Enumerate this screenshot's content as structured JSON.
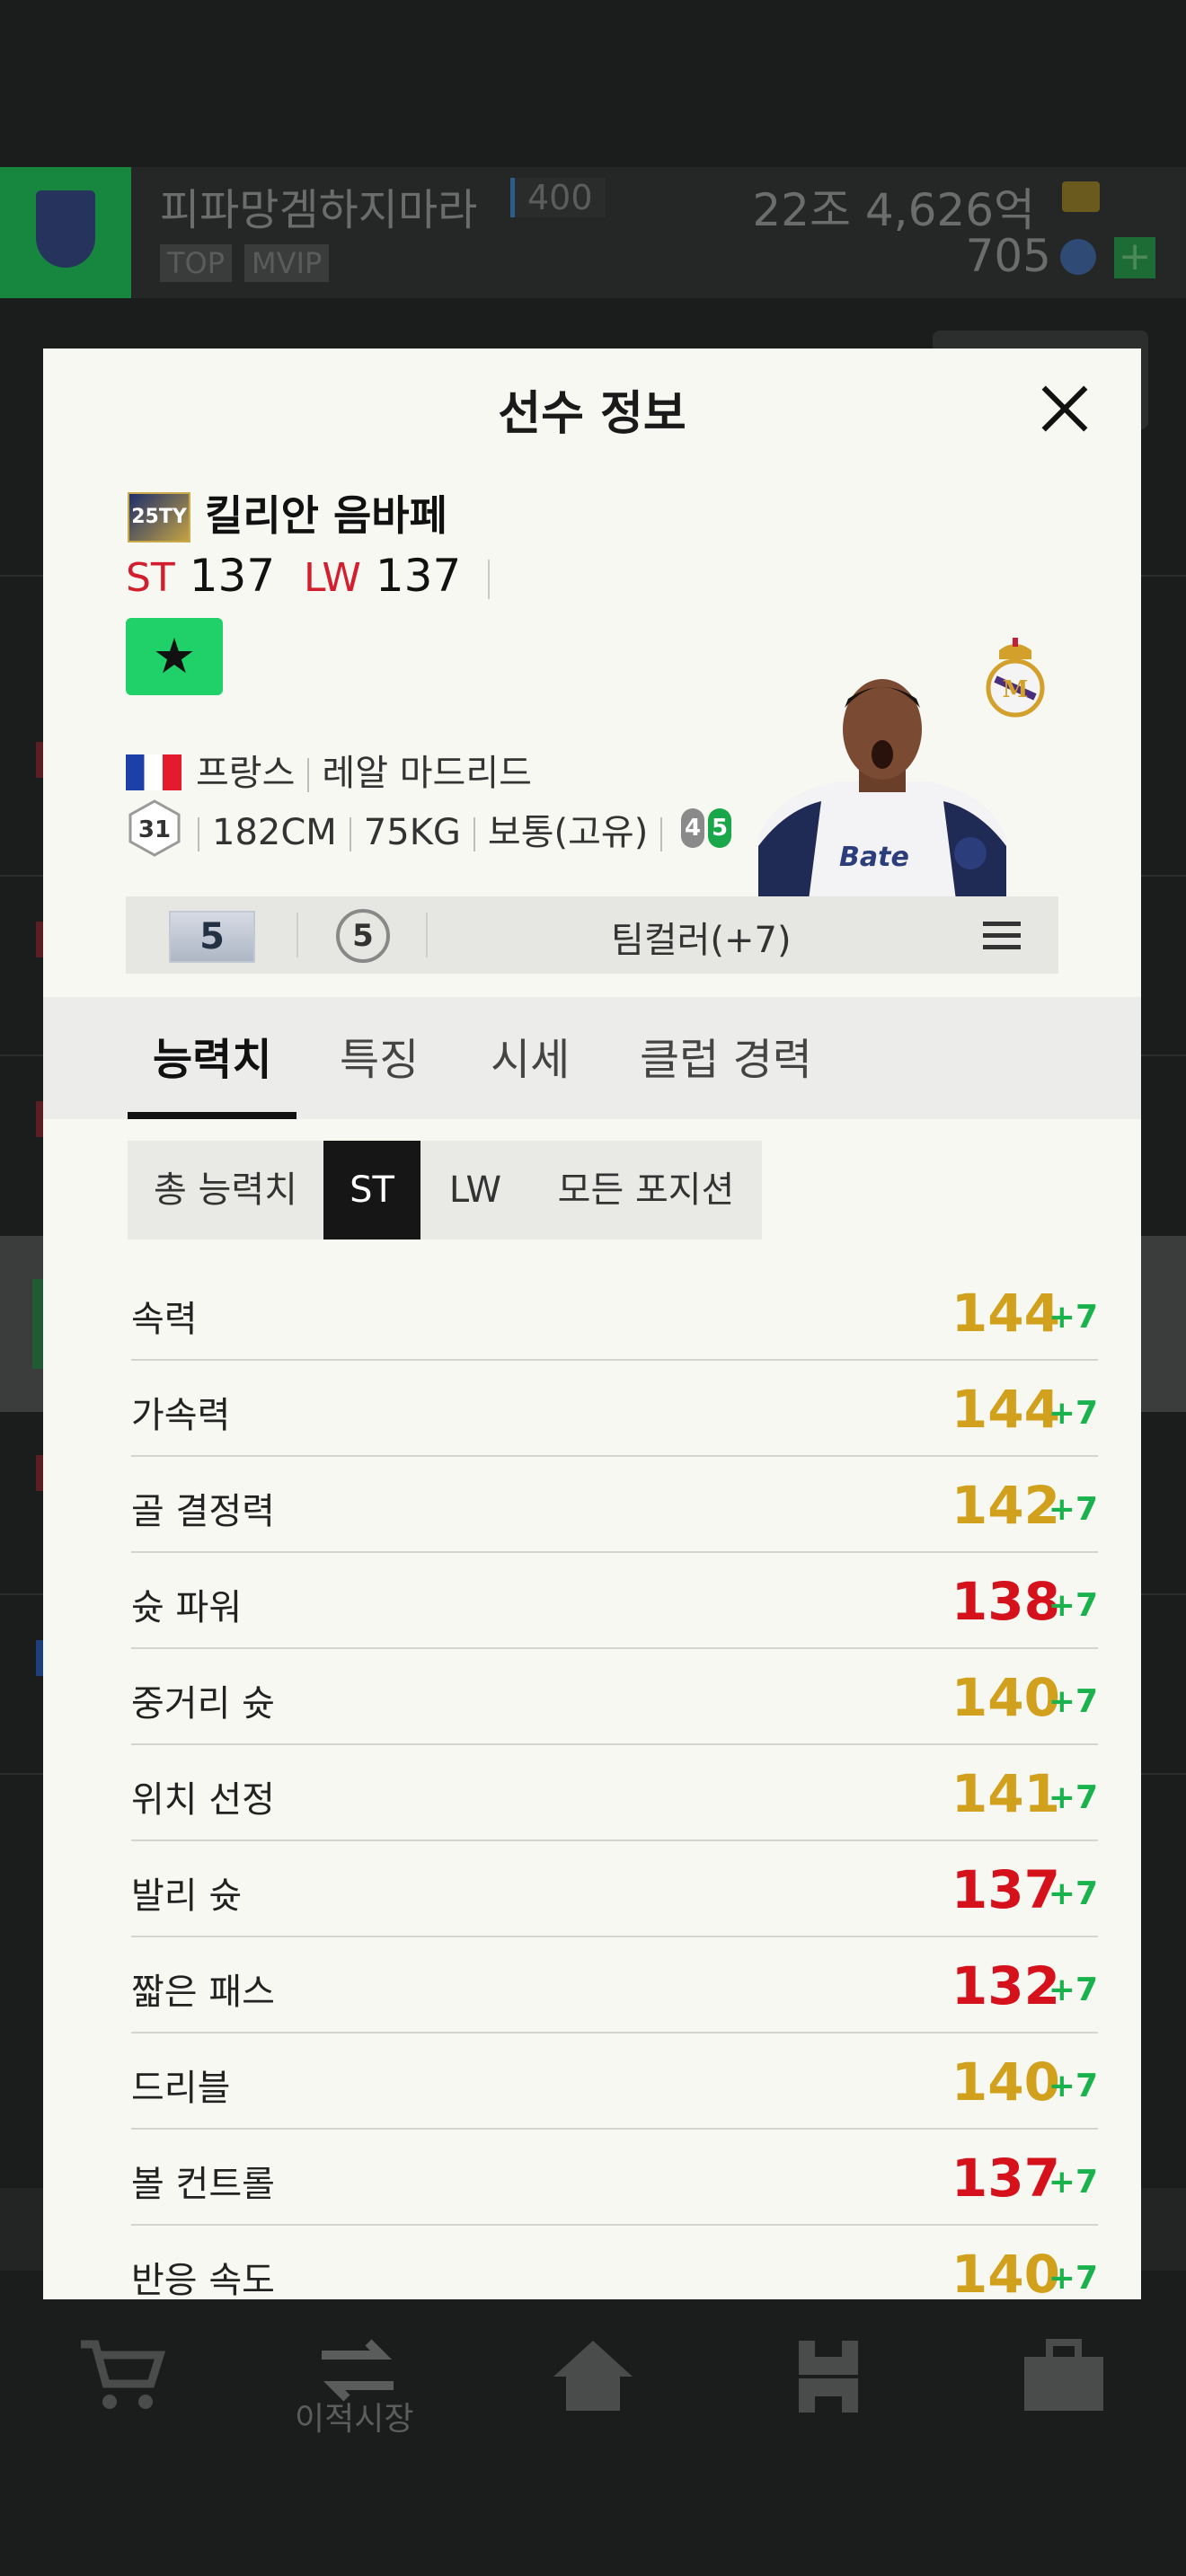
{
  "background": {
    "profile_name": "피파망겜하지마라",
    "profile_level": "400",
    "badge_top": "TOP",
    "badge_mvip": "MVIP",
    "bp_amount": "22조 4,626억",
    "fc_amount": "705",
    "plus_label": "+",
    "nav_transfer_label": "이적시장"
  },
  "modal": {
    "title": "선수 정보",
    "close_label": "close"
  },
  "player": {
    "season_badge": "25TY",
    "name": "킬리안 음바페",
    "positions": [
      {
        "pos": "ST",
        "ovr": "137"
      },
      {
        "pos": "LW",
        "ovr": "137"
      }
    ],
    "grade_symbol": "★",
    "nation": "프랑스",
    "club": "레알 마드리드",
    "age": "31",
    "height": "182CM",
    "weight": "75KG",
    "body_type": "보통(고유)",
    "weak_foot": "4",
    "strong_foot": "5"
  },
  "action_bar": {
    "level": "5",
    "enhance": "5",
    "team_color": "팀컬러(+7)"
  },
  "tabs": [
    "능력치",
    "특징",
    "시세",
    "클럽 경력"
  ],
  "subtabs": [
    "총 능력치",
    "ST",
    "LW",
    "모든 포지션"
  ],
  "stats": [
    {
      "name": "속력",
      "value": "144",
      "plus": "+7",
      "tier": "gold"
    },
    {
      "name": "가속력",
      "value": "144",
      "plus": "+7",
      "tier": "gold"
    },
    {
      "name": "골 결정력",
      "value": "142",
      "plus": "+7",
      "tier": "gold"
    },
    {
      "name": "슛 파워",
      "value": "138",
      "plus": "+7",
      "tier": "red"
    },
    {
      "name": "중거리 슛",
      "value": "140",
      "plus": "+7",
      "tier": "gold"
    },
    {
      "name": "위치 선정",
      "value": "141",
      "plus": "+7",
      "tier": "gold"
    },
    {
      "name": "발리 슛",
      "value": "137",
      "plus": "+7",
      "tier": "red"
    },
    {
      "name": "짧은 패스",
      "value": "132",
      "plus": "+7",
      "tier": "red"
    },
    {
      "name": "드리블",
      "value": "140",
      "plus": "+7",
      "tier": "gold"
    },
    {
      "name": "볼 컨트롤",
      "value": "137",
      "plus": "+7",
      "tier": "red"
    },
    {
      "name": "반응 속도",
      "value": "140",
      "plus": "+7",
      "tier": "gold"
    }
  ],
  "colors": {
    "gold": "#d1a01c",
    "red": "#d5121c",
    "plus_green": "#19b24c",
    "grade_green": "#1fd168",
    "position_red": "#d31f2d"
  }
}
